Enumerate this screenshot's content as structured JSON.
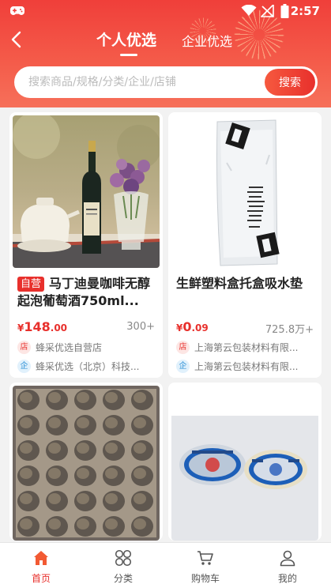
{
  "status_bar": {
    "time": "2:57",
    "icons": [
      "game-controller-icon",
      "wifi-icon",
      "no-signal-icon",
      "battery-icon"
    ]
  },
  "header": {
    "back_icon": "chevron-left-icon",
    "tabs": [
      {
        "label": "个人优选",
        "active": true
      },
      {
        "label": "企业优选",
        "active": false
      }
    ]
  },
  "search": {
    "placeholder": "搜索商品/规格/分类/企业/店铺",
    "value": "",
    "button_label": "搜索"
  },
  "products": [
    {
      "badge": "自营",
      "title": "马丁迪曼咖啡无醇起泡葡萄酒750ml...",
      "price_currency": "¥",
      "price_integer": "148",
      "price_decimal": ".00",
      "sales": "300+",
      "store_icon_label": "店",
      "store": "蜂采优选自营店",
      "company_icon_label": "企",
      "company": "蜂采优选（北京）科技..."
    },
    {
      "badge": "",
      "title": "生鲜塑料盒托盒吸水垫",
      "price_currency": "¥",
      "price_integer": "0",
      "price_decimal": ".09",
      "sales": "725.8万+",
      "store_icon_label": "店",
      "store": "上海第云包装材料有限...",
      "company_icon_label": "企",
      "company": "上海第云包装材料有限..."
    },
    {
      "title": ""
    },
    {
      "title": ""
    }
  ],
  "bottom_nav": [
    {
      "label": "首页",
      "icon": "home-icon",
      "active": true
    },
    {
      "label": "分类",
      "icon": "category-grid-icon",
      "active": false
    },
    {
      "label": "购物车",
      "icon": "shopping-cart-icon",
      "active": false
    },
    {
      "label": "我的",
      "icon": "user-profile-icon",
      "active": false
    }
  ],
  "colors": {
    "primary_red": "#e8302c",
    "header_gradient_top": "#f03f3a",
    "header_gradient_bottom": "#f6705a",
    "company_blue": "#2b8fd6"
  }
}
